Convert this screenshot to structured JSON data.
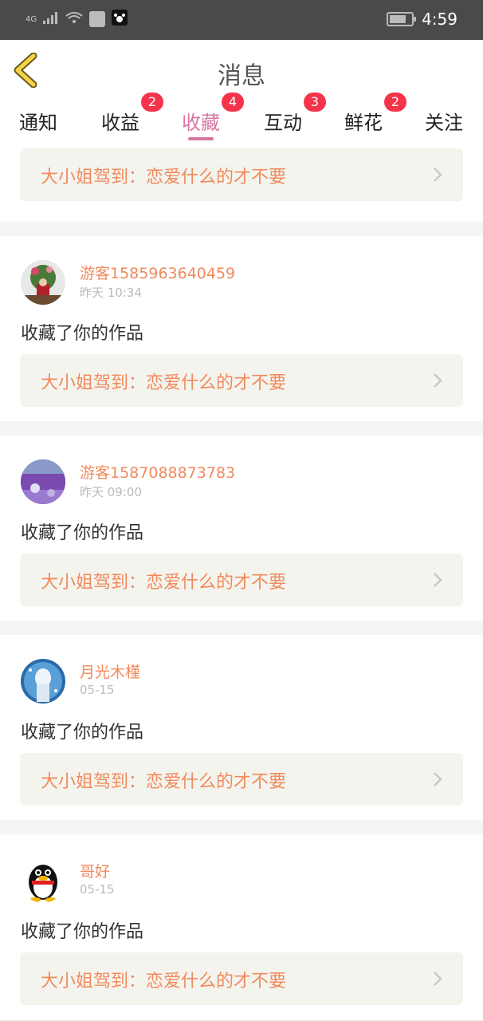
{
  "status_bar": {
    "network": "4G",
    "time": "4:59"
  },
  "header": {
    "title": "消息"
  },
  "tabs": [
    {
      "label": "通知",
      "badge": ""
    },
    {
      "label": "收益",
      "badge": "2"
    },
    {
      "label": "收藏",
      "badge": "4"
    },
    {
      "label": "互动",
      "badge": "3"
    },
    {
      "label": "鲜花",
      "badge": "2"
    },
    {
      "label": "关注",
      "badge": ""
    }
  ],
  "active_tab_index": 2,
  "colors": {
    "accent_pink": "#d876a1",
    "badge_red": "#f5334b",
    "username_orange": "#f08a5d",
    "work_box_bg": "#f4f4ee"
  },
  "top_work": {
    "title": "大小姐驾到：恋爱什么的才不要"
  },
  "messages": [
    {
      "username": "游客1585963640459",
      "time": "昨天 10:34",
      "text": "收藏了你的作品",
      "work_title": "大小姐驾到：恋爱什么的才不要",
      "avatar": "avatar-flowers-person"
    },
    {
      "username": "游客1587088873783",
      "time": "昨天 09:00",
      "text": "收藏了你的作品",
      "work_title": "大小姐驾到：恋爱什么的才不要",
      "avatar": "avatar-lavender-field"
    },
    {
      "username": "月光木槿",
      "time": "05-15",
      "text": "收藏了你的作品",
      "work_title": "大小姐驾到：恋爱什么的才不要",
      "avatar": "avatar-anime-girl"
    },
    {
      "username": "哥好",
      "time": "05-15",
      "text": "收藏了你的作品",
      "work_title": "大小姐驾到：恋爱什么的才不要",
      "avatar": "avatar-qq-penguin"
    }
  ]
}
